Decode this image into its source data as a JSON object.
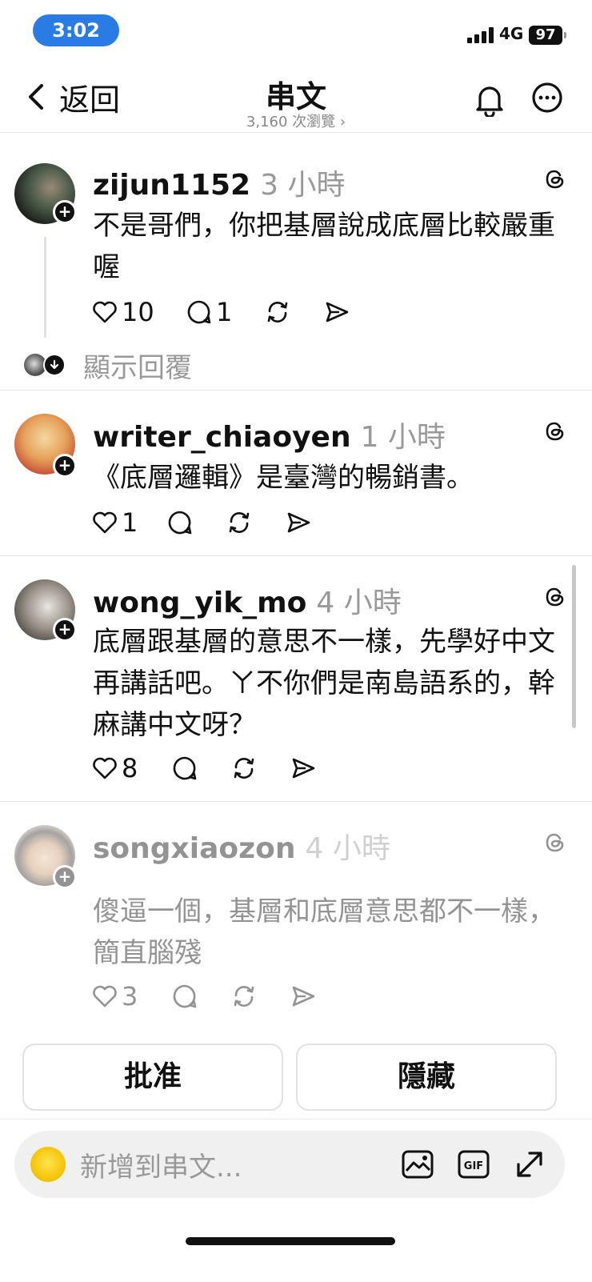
{
  "status_bar": {
    "time": "3:02",
    "network": "4G",
    "battery": "97"
  },
  "nav": {
    "back_label": "返回",
    "title": "串文",
    "views": "3,160 次瀏覽 ›"
  },
  "comments": [
    {
      "username": "zijun1152",
      "time": "3 小時",
      "text": "不是哥們，你把基層說成底層比較嚴重喔",
      "likes": "10",
      "replies": "1",
      "show_replies": "顯示回覆"
    },
    {
      "username": "writer_chiaoyen",
      "time": "1 小時",
      "text": "《底層邏輯》是臺灣的暢銷書。",
      "likes": "1"
    },
    {
      "username": "wong_yik_mo",
      "time": "4 小時",
      "text": "底層跟基層的意思不一樣，先學好中文再講話吧。ㄚ不你們是南島語系的，幹麻講中文呀？",
      "likes": "8"
    },
    {
      "username": "songxiaozon",
      "time": "4 小時",
      "text": "傻逼一個，基層和底層意思都不一樣，簡直腦殘",
      "likes": "3"
    }
  ],
  "buttons": {
    "approve": "批准",
    "hide": "隱藏"
  },
  "compose": {
    "placeholder": "新增到串文..."
  },
  "icons": [
    "chevron-left-icon",
    "bell-icon",
    "more-icon",
    "threads-icon",
    "heart-icon",
    "comment-icon",
    "repost-icon",
    "share-icon",
    "image-icon",
    "gif-icon",
    "expand-icon"
  ]
}
